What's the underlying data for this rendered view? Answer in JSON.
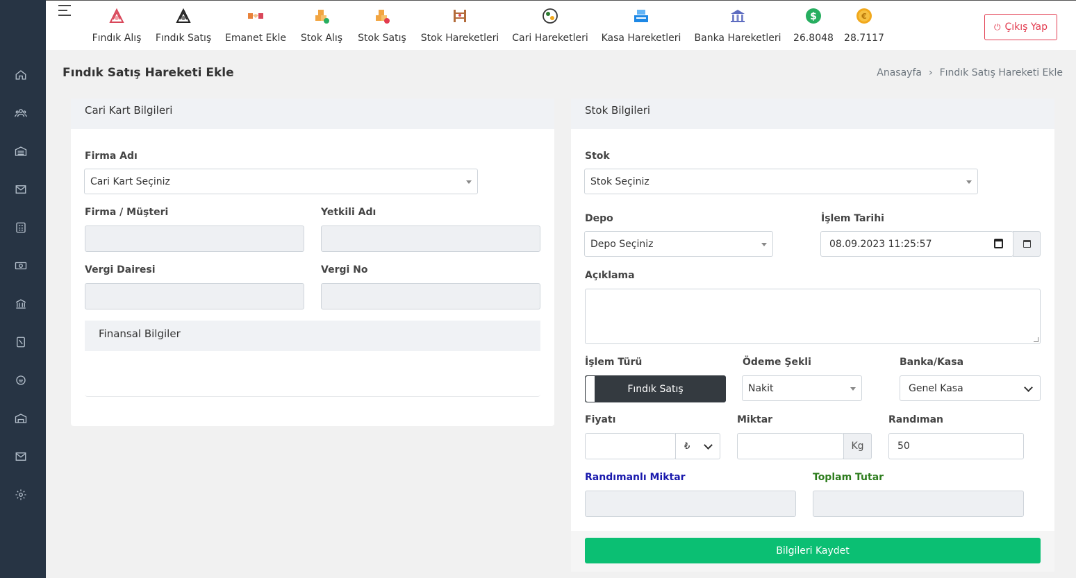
{
  "topnav": {
    "items": [
      {
        "label": "Fındık Alış",
        "icon": "hazelnut-buy-icon",
        "color": "#d9475a"
      },
      {
        "label": "Fındık Satış",
        "icon": "hazelnut-sell-icon",
        "color": "#222222"
      },
      {
        "label": "Emanet Ekle",
        "icon": "handshake-icon",
        "color": "#e8823a"
      },
      {
        "label": "Stok Alış",
        "icon": "boxes-in-icon",
        "color": "#f2a541"
      },
      {
        "label": "Stok Satış",
        "icon": "boxes-out-icon",
        "color": "#f2a541"
      },
      {
        "label": "Stok Hareketleri",
        "icon": "shelf-icon",
        "color": "#b36b3a"
      },
      {
        "label": "Cari Hareketleri",
        "icon": "money-exchange-icon",
        "color": "#2e7d32"
      },
      {
        "label": "Kasa Hareketleri",
        "icon": "cash-register-icon",
        "color": "#1e88e5"
      },
      {
        "label": "Banka Hareketleri",
        "icon": "bank-icon",
        "color": "#5c6bc0"
      },
      {
        "label": "26.8048",
        "icon": "dollar-coin-icon",
        "color": "#27ae60"
      },
      {
        "label": "28.7117",
        "icon": "euro-coin-icon",
        "color": "#f1a81c"
      }
    ],
    "logout_label": "Çıkış Yap"
  },
  "page": {
    "title": "Fındık Satış Hareketi Ekle",
    "breadcrumb": [
      "Anasayfa",
      "Fındık Satış Hareketi Ekle"
    ],
    "breadcrumb_sep": "›"
  },
  "left_card": {
    "title": "Cari Kart Bilgileri",
    "firma_label": "Firma Adı",
    "firma_value": "Cari Kart Seçiniz",
    "musteri_label": "Firma / Müşteri",
    "yetkili_label": "Yetkili Adı",
    "vergi_dairesi_label": "Vergi Dairesi",
    "vergi_no_label": "Vergi No",
    "finans_title": "Finansal Bilgiler"
  },
  "right_card": {
    "title": "Stok Bilgileri",
    "stok_label": "Stok",
    "stok_value": "Stok Seçiniz",
    "depo_label": "Depo",
    "depo_value": "Depo Seçiniz",
    "tarih_label": "İşlem Tarihi",
    "tarih_value": "08.09.2023 11:25:57",
    "aciklama_label": "Açıklama",
    "islem_turu_label": "İşlem Türü",
    "islem_turu_value": "Fındık Satış",
    "odeme_label": "Ödeme Şekli",
    "odeme_value": "Nakit",
    "banka_label": "Banka/Kasa",
    "banka_value": "Genel Kasa",
    "fiyat_label": "Fiyatı",
    "currency": "₺",
    "miktar_label": "Miktar",
    "miktar_unit": "Kg",
    "randiman_label": "Randıman",
    "randiman_value": "50",
    "randimanli_label": "Randımanlı Miktar",
    "toplam_label": "Toplam Tutar",
    "save_label": "Bilgileri Kaydet"
  },
  "colors": {
    "sidebar": "#273444",
    "save": "#0bbf73",
    "toggle": "#343a40",
    "randimanli": "#1a1aad",
    "toplam": "#2e7d1e",
    "danger": "#e23b4f"
  }
}
